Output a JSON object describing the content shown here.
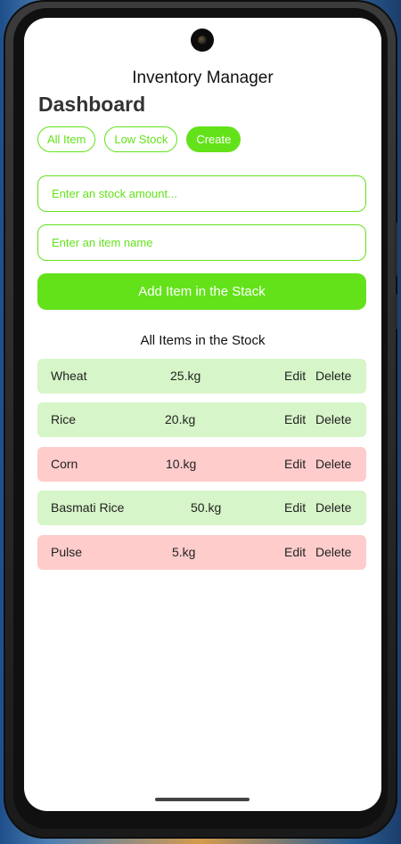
{
  "app": {
    "title": "Inventory Manager"
  },
  "dashboard": {
    "title": "Dashboard"
  },
  "tabs": [
    {
      "label": "All Item",
      "active": false
    },
    {
      "label": "Low Stock",
      "active": false
    },
    {
      "label": "Create",
      "active": true
    }
  ],
  "form": {
    "stock_placeholder": "Enter an stock amount...",
    "stock_value": "",
    "name_placeholder": "Enter an item name",
    "name_value": "",
    "add_label": "Add Item in the Stack"
  },
  "list": {
    "title": "All Items in the Stock",
    "edit_label": "Edit",
    "delete_label": "Delete",
    "items": [
      {
        "name": "Wheat",
        "qty": "25.kg",
        "status": "ok"
      },
      {
        "name": "Rice",
        "qty": "20.kg",
        "status": "ok"
      },
      {
        "name": "Corn",
        "qty": "10.kg",
        "status": "low"
      },
      {
        "name": "Basmati Rice",
        "qty": "50.kg",
        "status": "ok"
      },
      {
        "name": "Pulse",
        "qty": "5.kg",
        "status": "low"
      }
    ]
  },
  "colors": {
    "accent": "#63e21a",
    "row_ok": "#d6f5c8",
    "row_low": "#ffcccc"
  }
}
